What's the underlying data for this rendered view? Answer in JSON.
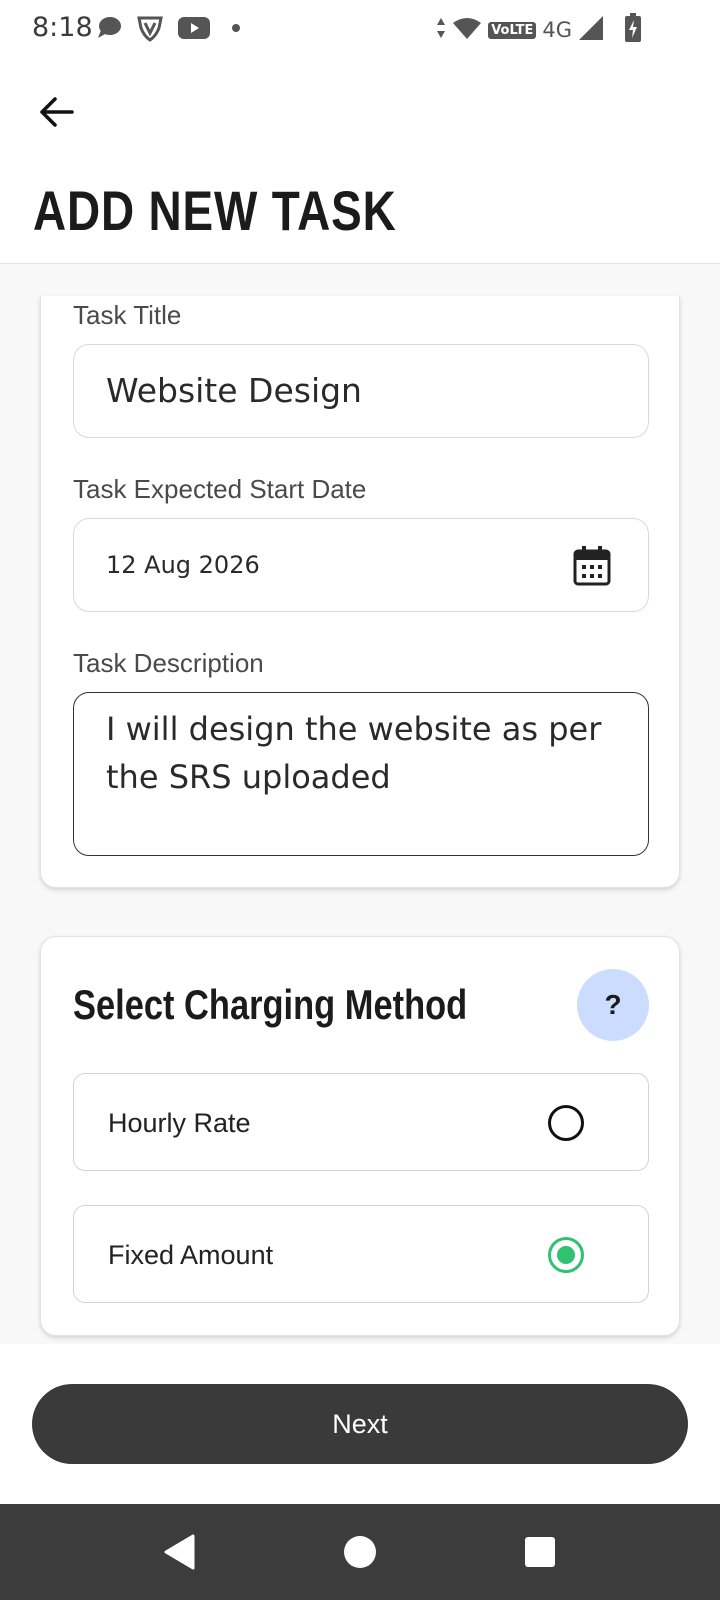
{
  "status_bar": {
    "time": "8:18",
    "network_badge": "VoLTE",
    "network_type": "4G",
    "icons": [
      "chat-bubble-icon",
      "vpn-shield-icon",
      "youtube-icon",
      "dot-icon",
      "data-arrows-icon",
      "wifi-icon",
      "signal-icon",
      "battery-charging-icon"
    ]
  },
  "header": {
    "back_icon": "arrow-left-icon",
    "title": "ADD NEW TASK"
  },
  "task_form": {
    "title_label": "Task Title",
    "title_value": "Website Design",
    "start_date_label": "Task Expected Start Date",
    "start_date_value": "12 Aug 2026",
    "calendar_icon": "calendar-icon",
    "description_label": "Task Description",
    "description_value": "I will design the website as per the SRS uploaded"
  },
  "charging": {
    "title": "Select Charging Method",
    "help_label": "?",
    "options": [
      {
        "label": "Hourly Rate",
        "selected": false
      },
      {
        "label": "Fixed Amount",
        "selected": true
      }
    ],
    "selected_color": "#2fc26f",
    "help_bg_color": "#ccdcff"
  },
  "footer": {
    "next_label": "Next",
    "button_color": "#3a3a3a"
  },
  "nav_bar": {
    "icons": [
      "nav-back-icon",
      "nav-home-icon",
      "nav-recents-icon"
    ]
  }
}
